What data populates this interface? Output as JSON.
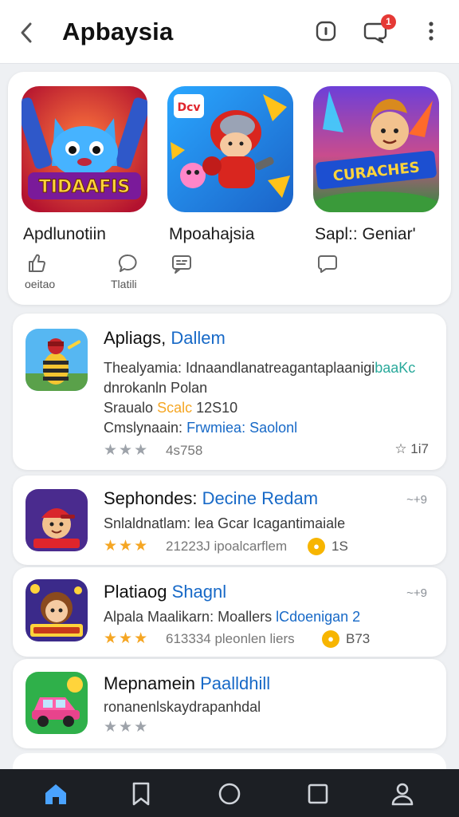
{
  "header": {
    "title": "Apbaysia",
    "notification_count": "1"
  },
  "featured": [
    {
      "name": "Apdlunotiin",
      "art_text": "TIDAAFIS",
      "sub_left": "oeitao",
      "sub_right": "Tlatili"
    },
    {
      "name": "Mpoahajsia",
      "art_text": "Dcv",
      "sub_left": "",
      "sub_right": ""
    },
    {
      "name": "Sapl:: Geniar'",
      "art_text": "CURACHES",
      "sub_left": "",
      "sub_right": ""
    }
  ],
  "list": [
    {
      "title": "Apliags,",
      "title_accent": "Dallem",
      "line1": "Thealyamia: Idnaandlanatreagantaplaanigi",
      "line1_accent": "baaKc",
      "line2": "dnrokanln Polan",
      "line3_a": "Sraualo",
      "line3_b": "Scalc",
      "line3_c": "12S10",
      "line4_a": "Cmslynaain:",
      "line4_b": "Frwmiea: Saolonl",
      "stars": "★★★",
      "meta": "4s758",
      "rating": "☆ 1i7"
    },
    {
      "title": "Sephondes:",
      "title_accent": "Decine Redam",
      "line1": "Snlaldnatlam: lea Gcar Icagantimaiale",
      "stars": "★★★",
      "meta": "21223J ipoalcarflem",
      "coin": "1S",
      "num": "~+9"
    },
    {
      "title": "Platiaog",
      "title_accent": "Shagnl",
      "line1": "Alpala Maalikarn: Moallers",
      "line1_accent": "lCdoenigan 2",
      "stars": "★★★",
      "meta": "613334 pleonlen liers",
      "coin": "B73",
      "num": "~+9"
    },
    {
      "title": "Mepnamein",
      "title_accent": "Paalldhill",
      "line1": "ronanenlskaydrapanhdal",
      "stars": "★★★"
    }
  ],
  "colors": {
    "accent_blue": "#1769c7",
    "star_gold": "#f5a623",
    "nav_bg": "#1c1f24",
    "nav_active": "#4aa3ff",
    "badge_red": "#e53935"
  },
  "icons": {
    "back": "chevron-left-icon",
    "shield": "shield-icon",
    "notifications": "chat-bell-icon",
    "more": "more-vertical-icon",
    "nav": [
      "home-icon",
      "bookmark-icon",
      "circle-icon",
      "square-icon",
      "profile-icon"
    ]
  }
}
